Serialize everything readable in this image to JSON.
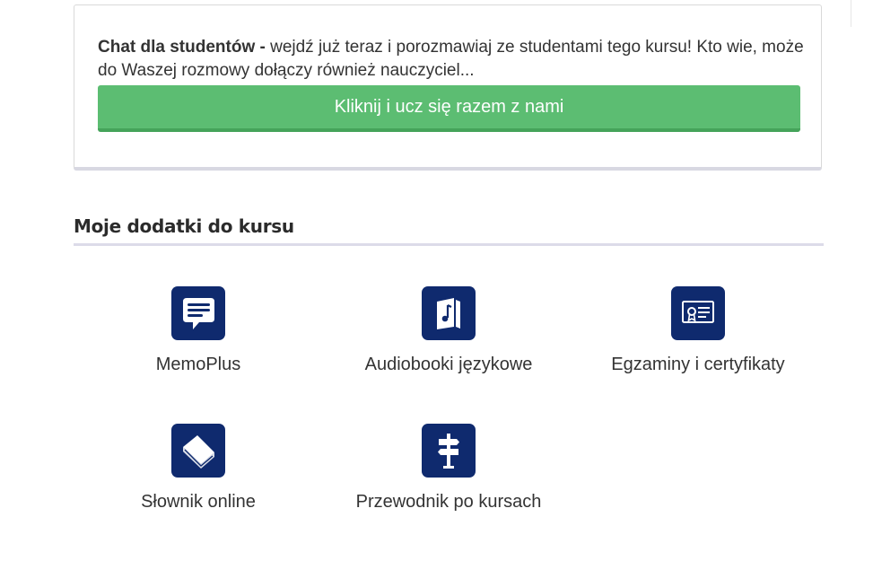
{
  "chat": {
    "title": "Chat dla studentów -",
    "description": "wejdź już teraz i porozmawiaj ze studentami tego kursu! Kto wie, może do Waszej rozmowy dołączy również nauczyciel...",
    "button_label": "Kliknij i ucz się razem z nami"
  },
  "addons": {
    "title": "Moje dodatki do kursu",
    "items": [
      {
        "label": "MemoPlus",
        "icon": "chat-bubble-icon"
      },
      {
        "label": "Audiobooki językowe",
        "icon": "audiobook-icon"
      },
      {
        "label": "Egzaminy i certyfikaty",
        "icon": "certificate-icon"
      },
      {
        "label": "Słownik online",
        "icon": "dictionary-book-icon"
      },
      {
        "label": "Przewodnik po kursach",
        "icon": "signpost-icon"
      }
    ]
  },
  "colors": {
    "button_green": "#5cbd72",
    "icon_navy": "#0f2a6e",
    "rule": "#dcdbe9"
  }
}
